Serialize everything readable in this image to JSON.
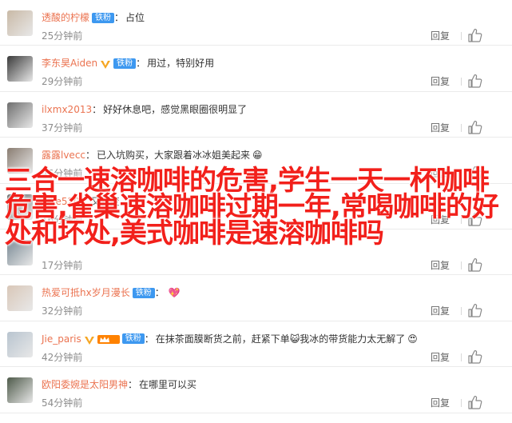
{
  "comments": [
    {
      "user": "透酸的柠檬",
      "badge": "铁粉",
      "verified": false,
      "text": "占位",
      "emoji": "",
      "time": "25分钟前"
    },
    {
      "user": "李东昊Aiden",
      "badge": "铁粉",
      "verified": true,
      "text": "用过，特别好用",
      "emoji": "",
      "time": "29分钟前"
    },
    {
      "user": "ilxmx2013",
      "badge": "",
      "verified": false,
      "text": "好好休息吧，感觉黑眼圈很明显了",
      "emoji": "",
      "time": "37分钟前"
    },
    {
      "user": "露露lvecc",
      "badge": "",
      "verified": false,
      "text": "已入坑购买，大家跟着冰冰姐美起来",
      "emoji": "😁",
      "time": "46分钟前"
    },
    {
      "user": "uike520",
      "badge": "",
      "verified": false,
      "text": "又要变…",
      "emoji": "",
      "time": "16分钟前"
    },
    {
      "user": "",
      "badge": "",
      "verified": false,
      "text": "",
      "emoji": "",
      "time": "17分钟前"
    },
    {
      "user": "热爱可抵hx岁月漫长",
      "badge": "铁粉",
      "verified": false,
      "text": "",
      "emoji": "💖",
      "time": "32分钟前"
    },
    {
      "user": "Jie_paris",
      "badge": "铁粉",
      "verified": true,
      "text": "在抹茶面膜断货之前，赶紧下单😺我冰的带货能力太无解了",
      "emoji": "😍",
      "time": "42分钟前"
    },
    {
      "user": "欧阳委婉是太阳男神",
      "badge": "",
      "verified": false,
      "text": "在哪里可以买",
      "emoji": "",
      "time": "54分钟前"
    }
  ],
  "reply_label": "回复",
  "overlay_text": "三合一速溶咖啡的危害,学生一天一杯咖啡危害,雀巢速溶咖啡过期一年,常喝咖啡的好处和坏处,美式咖啡是速溶咖啡吗",
  "colors": {
    "username": "#eb7350",
    "fan_badge": "#3d98f0",
    "overlay": "#f2201b"
  }
}
